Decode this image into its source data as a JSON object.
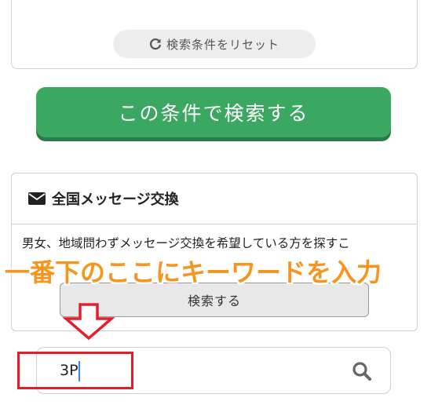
{
  "reset": {
    "label": "検索条件をリセット",
    "icon": "refresh-icon"
  },
  "submit": {
    "label": "この条件で検索する",
    "color": "#3aa861"
  },
  "message_card": {
    "title": "全国メッセージ交換",
    "icon": "envelope-icon",
    "description": "男女、地域問わずメッセージ交換を希望している方を探すこ",
    "search_label": "検索する"
  },
  "annotation": {
    "text": "一番下のここにキーワードを入力",
    "color": "#f7941d"
  },
  "keyword": {
    "value": "3P",
    "icon": "search-icon"
  },
  "highlight_color": "#e3202a"
}
